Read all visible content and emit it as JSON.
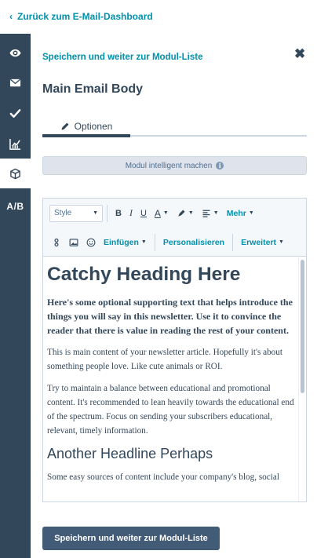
{
  "topbar": {
    "back_label": "Zurück zum E-Mail-Dashboard"
  },
  "rail": {
    "ab_label": "A/B"
  },
  "panel": {
    "save_link": "Speichern und weiter zur Modul-Liste",
    "module_title": "Main Email Body",
    "tab_label": "Optionen",
    "smart_module": "Modul intelligent machen",
    "smart_info": "i"
  },
  "toolbar": {
    "style_select": "Style",
    "bold": "B",
    "italic": "I",
    "underline": "U",
    "text_color": "A",
    "more": "Mehr",
    "insert": "Einfügen",
    "personalize": "Personalisieren",
    "advanced": "Erweitert"
  },
  "content": {
    "heading": "Catchy Heading Here",
    "lead": "Here's some optional supporting text that helps introduce the things you will say in this newsletter. Use it to convince the reader that there is value in reading the rest of your content.",
    "p1": "This is main content of your newsletter article. Hopefully it's about something people love. Like cute animals or ROI.",
    "p2": "Try to maintain a balance between educational and promotional content. It's recommended to lean heavily towards the educational end of the spectrum. Focus on sending your subscribers educational, relevant, timely information.",
    "heading2": "Another Headline Perhaps",
    "p3": "Some easy sources of content include your company's blog, social"
  },
  "footer": {
    "primary_button": "Speichern und weiter zur Modul-Liste"
  }
}
